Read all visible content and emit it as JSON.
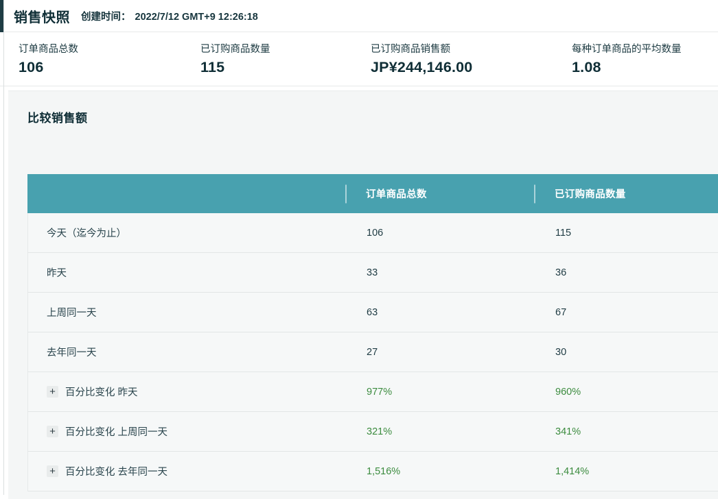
{
  "header": {
    "title": "销售快照",
    "created_label": "创建时间：",
    "created_value": "2022/7/12 GMT+9 12:26:18"
  },
  "stats": [
    {
      "label": "订单商品总数",
      "value": "106"
    },
    {
      "label": "已订购商品数量",
      "value": "115"
    },
    {
      "label": "已订购商品销售额",
      "value": "JP¥244,146.00"
    },
    {
      "label": "每种订单商品的平均数量",
      "value": "1.08"
    }
  ],
  "section": {
    "title": "比较销售额"
  },
  "table": {
    "expand_icon": "+",
    "columns": [
      "",
      "订单商品总数",
      "已订购商品数量"
    ],
    "rows": [
      {
        "label": "今天（迄今为止）",
        "values": [
          "106",
          "115"
        ]
      },
      {
        "label": "昨天",
        "values": [
          "33",
          "36"
        ]
      },
      {
        "label": "上周同一天",
        "values": [
          "63",
          "67"
        ]
      },
      {
        "label": "去年同一天",
        "values": [
          "27",
          "30"
        ]
      },
      {
        "label": "百分比变化 昨天",
        "values": [
          "977%",
          "960%"
        ],
        "expandable": true,
        "positive": true
      },
      {
        "label": "百分比变化 上周同一天",
        "values": [
          "321%",
          "341%"
        ],
        "expandable": true,
        "positive": true
      },
      {
        "label": "百分比变化 去年同一天",
        "values": [
          "1,516%",
          "1,414%"
        ],
        "expandable": true,
        "positive": true
      }
    ]
  },
  "colors": {
    "header_teal": "#48a1af",
    "positive_green": "#3b8b3e",
    "dark_text": "#0f2e36"
  }
}
